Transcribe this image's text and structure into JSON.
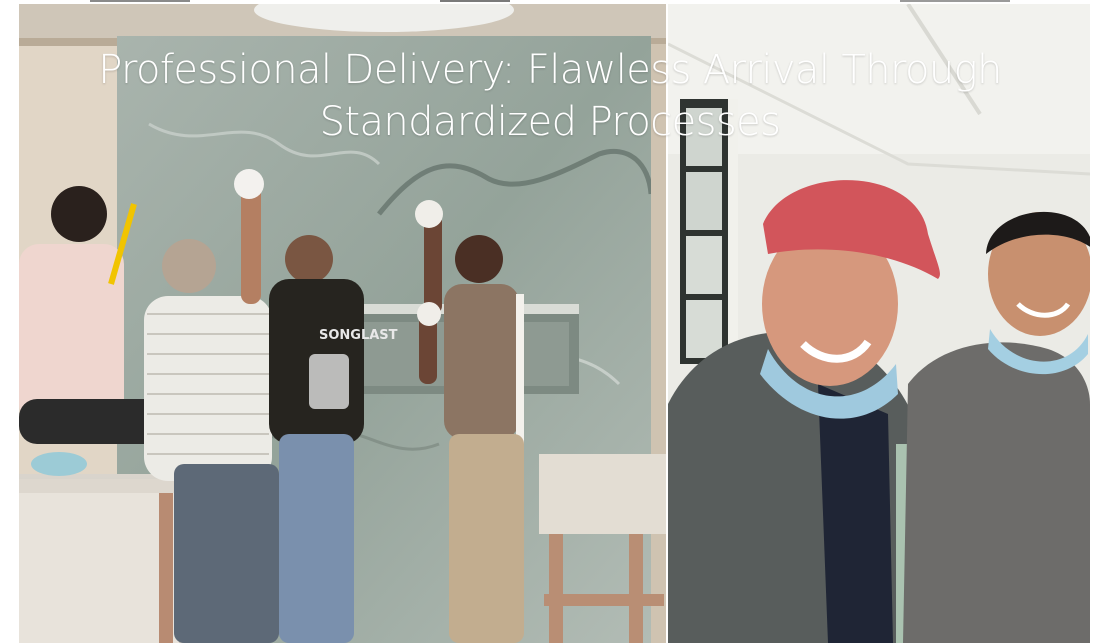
{
  "headline": {
    "line1": "Professional Delivery: Flawless Arrival Through",
    "line2": "Standardized Processes"
  },
  "photos": {
    "left": {
      "shirt_print": "SONGLAST"
    }
  },
  "colors": {
    "text": "#ffffff",
    "marble": "#9aa79f",
    "cap": "#d2555b",
    "mask": "#9fc9de"
  }
}
